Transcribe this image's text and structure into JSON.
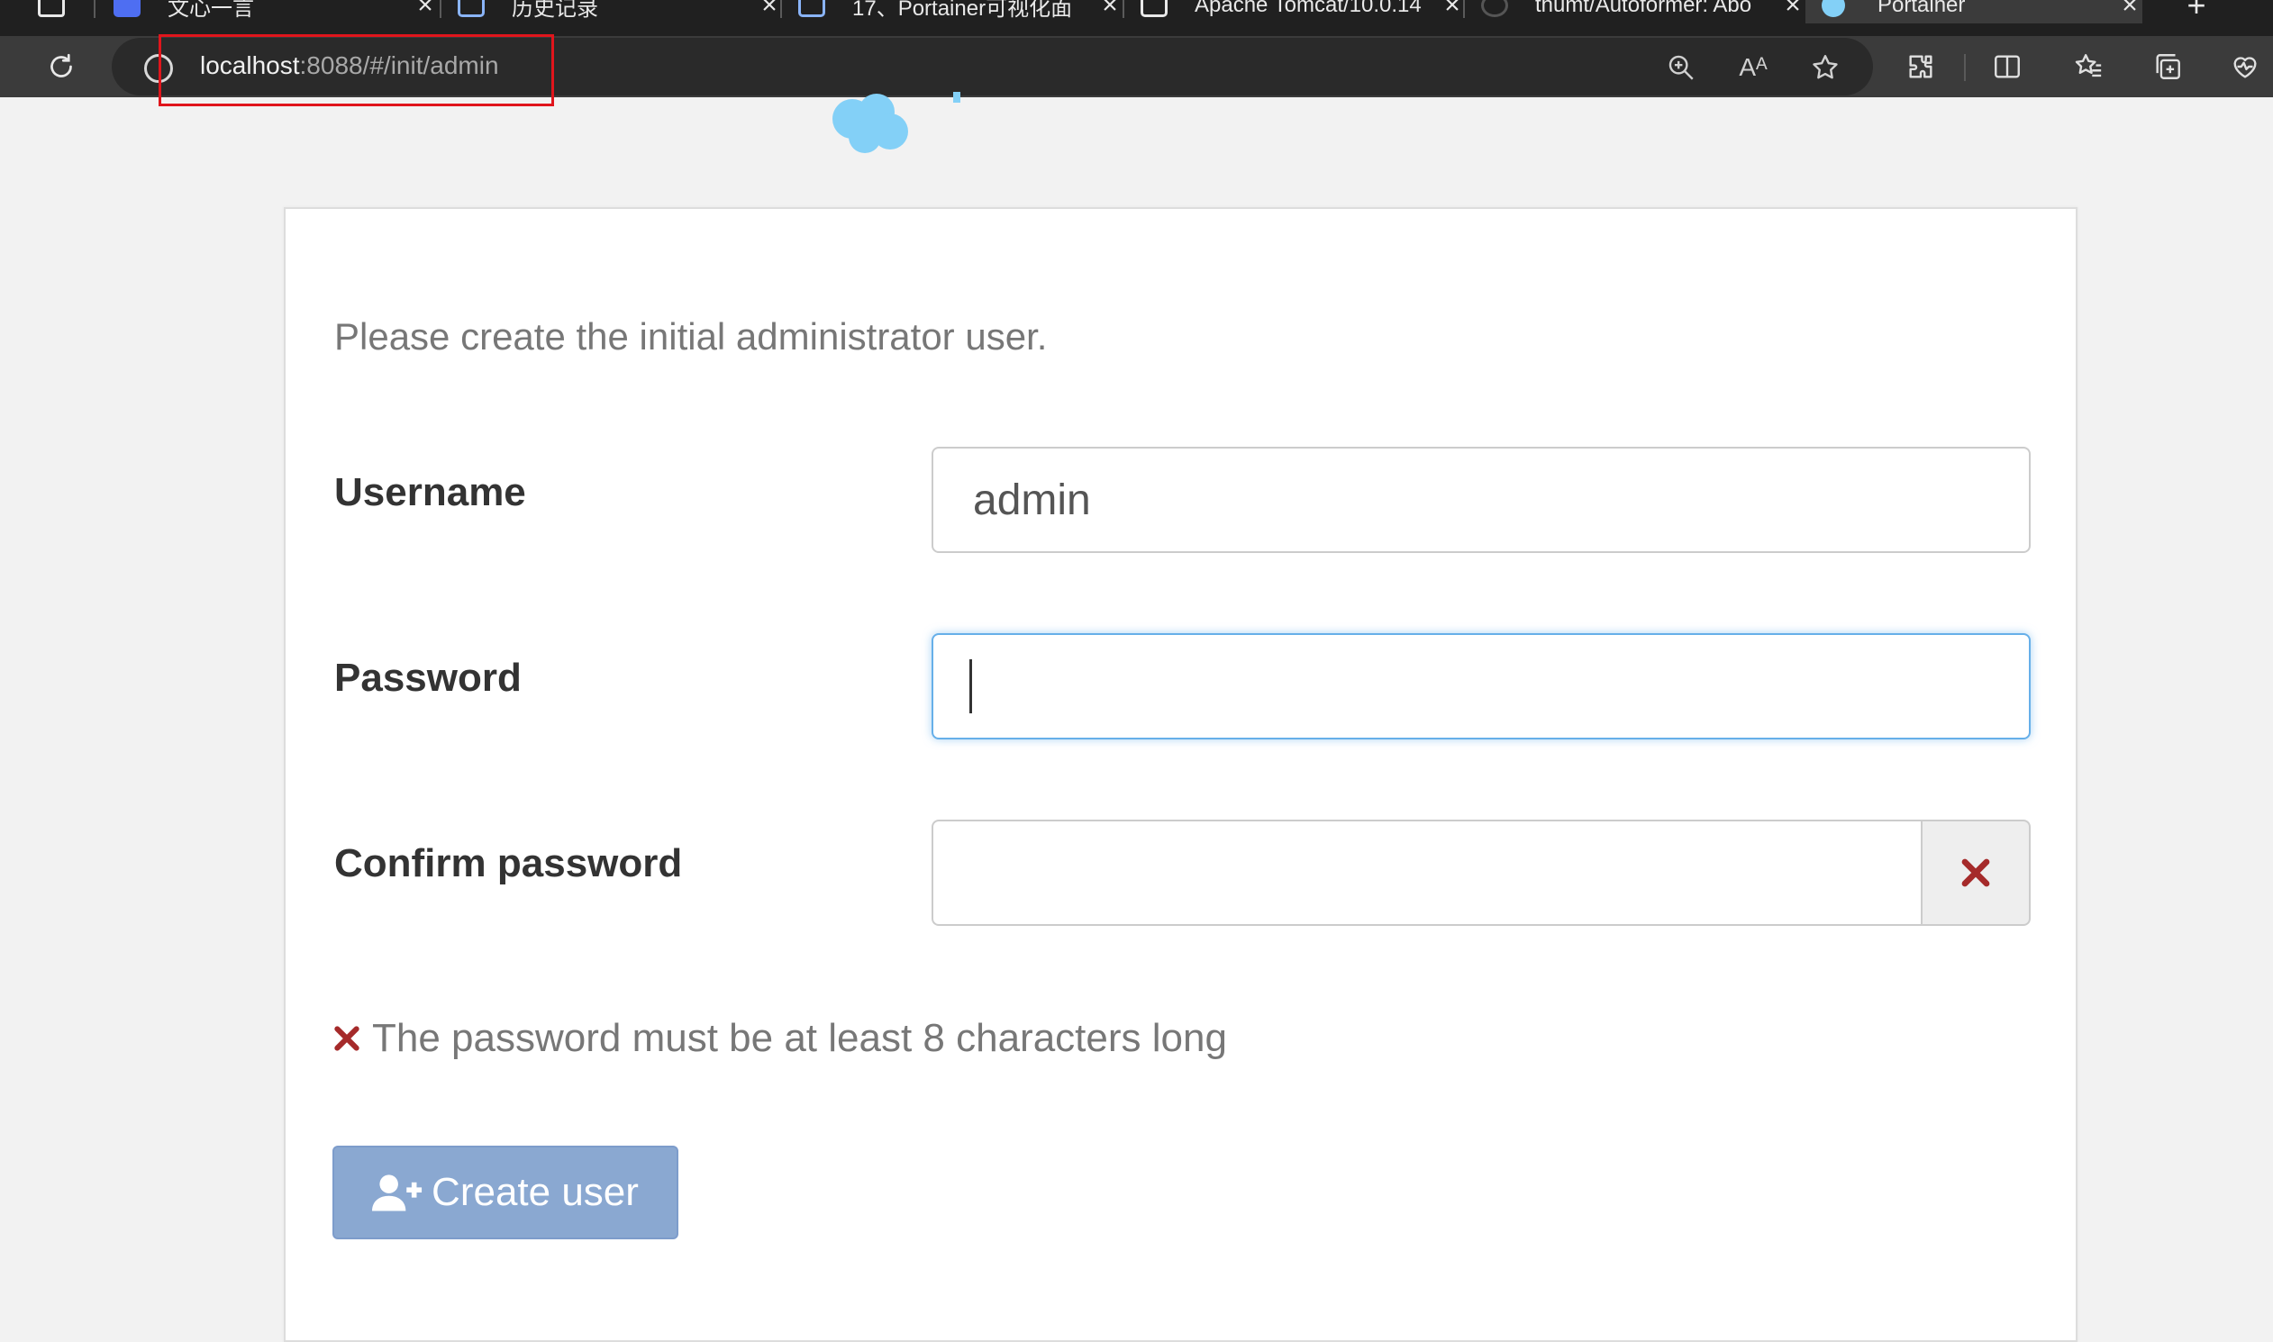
{
  "browser": {
    "tabs": [
      {
        "title": "文心一言",
        "active": false
      },
      {
        "title": "历史记录",
        "active": false
      },
      {
        "title": "17、Portainer可视化面",
        "active": false
      },
      {
        "title": "Apache Tomcat/10.0.14",
        "active": false
      },
      {
        "title": "thumt/Autoformer: Abo",
        "active": false
      },
      {
        "title": "Portainer",
        "active": true
      }
    ],
    "new_tab_label": "+",
    "close_glyph": "×",
    "address": {
      "host": "localhost",
      "rest": ":8088/#/init/admin"
    },
    "toolbar_icons": [
      "reload-icon",
      "site-info-icon",
      "zoom-icon",
      "read-aloud-icon",
      "favorite-star-icon",
      "extensions-icon",
      "split-screen-icon",
      "favorites-icon",
      "collections-icon",
      "browser-essentials-icon"
    ],
    "read_aloud_label": "Aᴬ"
  },
  "annotation": {
    "color": "#e0151c"
  },
  "form": {
    "intro": "Please create the initial administrator user.",
    "username_label": "Username",
    "username_value": "admin",
    "password_label": "Password",
    "password_value": "",
    "confirm_label": "Confirm password",
    "confirm_value": "",
    "error_message": "The password must be at least 8 characters long",
    "submit_label": "Create user"
  },
  "colors": {
    "error": "#a52a2a",
    "button": "#8aa8d1",
    "focus": "#66afe9",
    "logo": "#83d0f7"
  }
}
